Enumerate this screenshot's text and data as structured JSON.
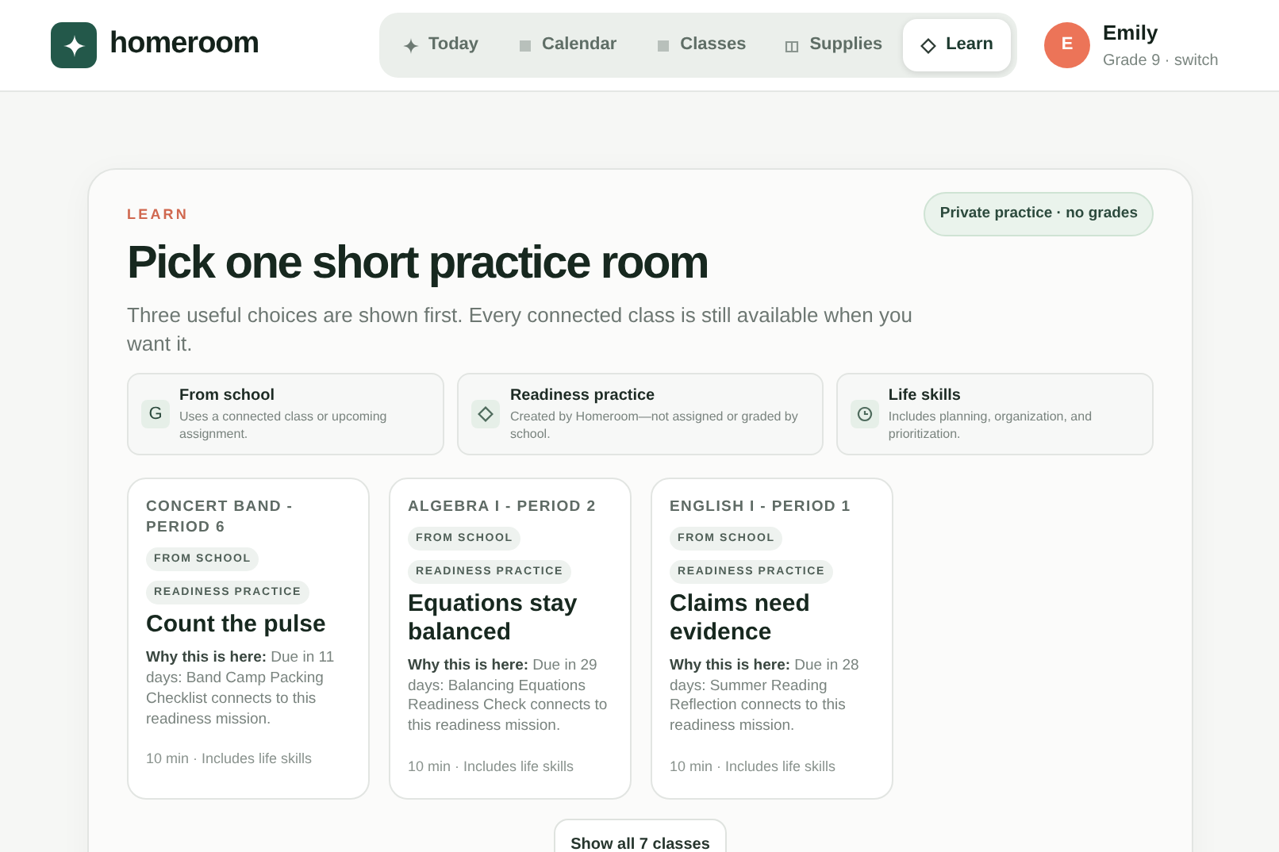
{
  "app": {
    "name": "homeroom"
  },
  "nav": [
    {
      "label": "Today",
      "kind": "sparkle",
      "selected": false
    },
    {
      "label": "Calendar",
      "kind": "square",
      "selected": false
    },
    {
      "label": "Classes",
      "kind": "square",
      "selected": false
    },
    {
      "label": "Supplies",
      "kind": "columns",
      "selected": false
    },
    {
      "label": "Learn",
      "kind": "diamond",
      "selected": true
    }
  ],
  "user": {
    "initial": "E",
    "name": "Emily",
    "detail": "Grade 9 · switch"
  },
  "page": {
    "eyebrow": "LEARN",
    "privacy_badge": "Private practice · no grades",
    "title": "Pick one short practice room",
    "subtitle": "Three useful choices are shown first. Every connected class is still available when you want it."
  },
  "legend": [
    {
      "kind": "letter",
      "glyph": "G",
      "title": "From school",
      "text": "Uses a connected class or upcoming assignment."
    },
    {
      "kind": "diamond",
      "title": "Readiness practice",
      "text": "Created by Homeroom—not assigned or graded by school."
    },
    {
      "kind": "clock",
      "title": "Life skills",
      "text": "Includes planning, organization, and prioritization."
    }
  ],
  "rooms": [
    {
      "class": "CONCERT BAND - PERIOD 6",
      "tags": [
        "FROM SCHOOL",
        "READINESS PRACTICE"
      ],
      "title": "Count the pulse",
      "why": "**Why this is here:** Due in 11 days: Band Camp Packing Checklist connects to this readiness mission.",
      "meta": "10 min · Includes life skills"
    },
    {
      "class": "ALGEBRA I - PERIOD 2",
      "tags": [
        "FROM SCHOOL",
        "READINESS PRACTICE"
      ],
      "title": "Equations stay balanced",
      "why": "**Why this is here:** Due in 29 days: Balancing Equations Readiness Check connects to this readiness mission.",
      "meta": "10 min · Includes life skills"
    },
    {
      "class": "ENGLISH I - PERIOD 1",
      "tags": [
        "FROM SCHOOL",
        "READINESS PRACTICE"
      ],
      "title": "Claims need evidence",
      "why": "**Why this is here:** Due in 28 days: Summer Reading Reflection connects to this readiness mission.",
      "meta": "10 min · Includes life skills"
    }
  ],
  "show_all_button": "Show all 7 classes"
}
